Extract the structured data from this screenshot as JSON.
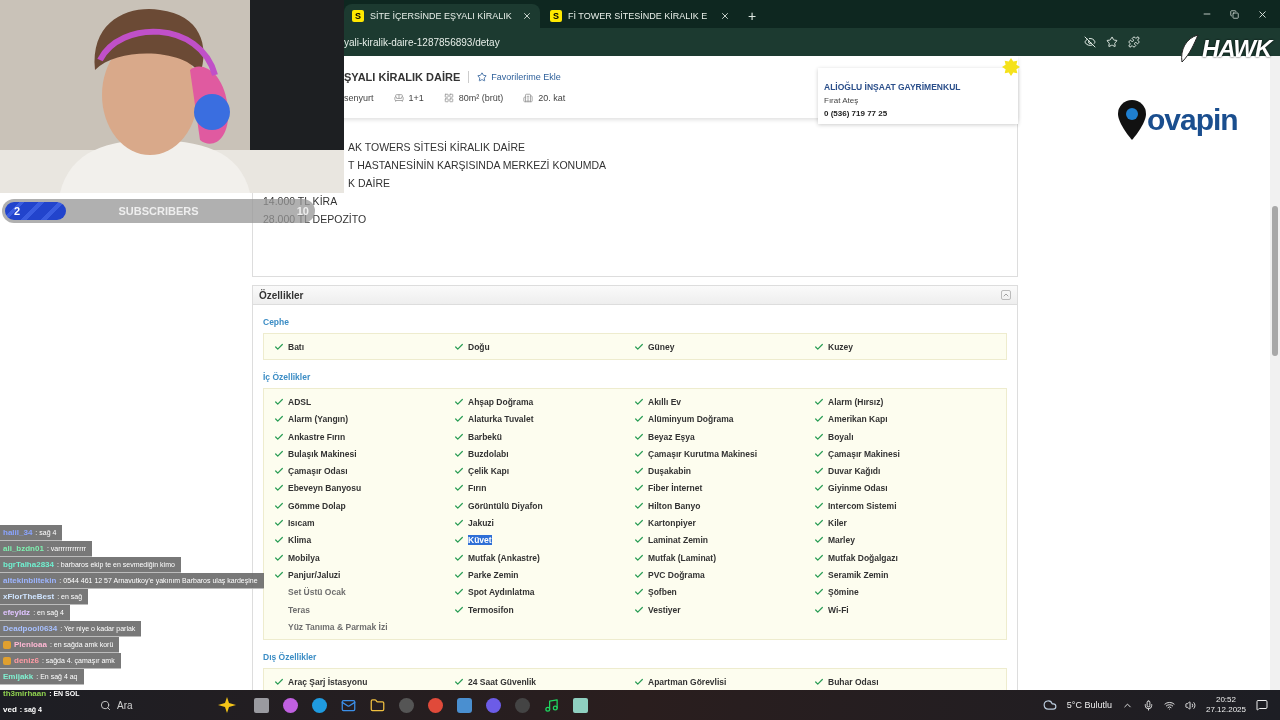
{
  "browser": {
    "tabs": [
      {
        "title": "SİTE İÇERSİNDE EŞYALI KİRALIK",
        "favicon": "S",
        "selected": true
      },
      {
        "title": "Fİ TOWER SİTESİNDE KİRALIK E",
        "favicon": "S",
        "selected": false
      }
    ],
    "new_tab": "+",
    "url": "yali-kiralik-daire-1287856893/detay"
  },
  "listing": {
    "title": "ŞYALI KİRALIK DAİRE",
    "favorite": "Favorilerime Ekle",
    "facts": [
      {
        "kind": "place",
        "text": "senyurt"
      },
      {
        "kind": "rooms",
        "text": "1+1"
      },
      {
        "kind": "area",
        "text": "80m² (brüt)"
      },
      {
        "kind": "floor",
        "text": "20. kat"
      }
    ],
    "seller": {
      "company": "ALİOĞLU İNŞAAT GAYRİMENKUL",
      "name": "Fırat Ateş",
      "phone": "0 (536) 719 77 25"
    },
    "description": [
      {
        "kind": "cut",
        "text": "AK TOWERS SİTESİ KİRALIK DAİRE"
      },
      {
        "kind": "cut",
        "text": "T HASTANESİNİN KARŞISINDA MERKEZİ KONUMDA"
      },
      {
        "kind": "cut",
        "text": "K DAİRE"
      },
      {
        "kind": "full",
        "text": "14.000 TL KİRA"
      },
      {
        "kind": "full",
        "text": "28.000 TL DEPOZİTO"
      }
    ]
  },
  "features": {
    "title": "Özellikler",
    "groups": [
      {
        "title": "Cephe",
        "columns": [
          [
            {
              "label": "Batı",
              "checked": true,
              "highlighted": false
            }
          ],
          [
            {
              "label": "Doğu",
              "checked": true,
              "highlighted": false
            }
          ],
          [
            {
              "label": "Güney",
              "checked": true,
              "highlighted": false
            }
          ],
          [
            {
              "label": "Kuzey",
              "checked": true,
              "highlighted": false
            }
          ]
        ]
      },
      {
        "title": "İç Özellikler",
        "columns": [
          [
            {
              "label": "ADSL",
              "checked": true,
              "highlighted": false
            },
            {
              "label": "Alarm (Yangın)",
              "checked": true,
              "highlighted": false
            },
            {
              "label": "Ankastre Fırın",
              "checked": true,
              "highlighted": false
            },
            {
              "label": "Bulaşık Makinesi",
              "checked": true,
              "highlighted": false
            },
            {
              "label": "Çamaşır Odası",
              "checked": true,
              "highlighted": false
            },
            {
              "label": "Ebeveyn Banyosu",
              "checked": true,
              "highlighted": false
            },
            {
              "label": "Gömme Dolap",
              "checked": true,
              "highlighted": false
            },
            {
              "label": "Isıcam",
              "checked": true,
              "highlighted": false
            },
            {
              "label": "Klima",
              "checked": true,
              "highlighted": false
            },
            {
              "label": "Mobilya",
              "checked": true,
              "highlighted": false
            },
            {
              "label": "Panjur/Jaluzi",
              "checked": true,
              "highlighted": false
            },
            {
              "label": "Set Üstü Ocak",
              "checked": false,
              "highlighted": false
            },
            {
              "label": "Teras",
              "checked": false,
              "highlighted": false
            },
            {
              "label": "Yüz Tanıma & Parmak İzi",
              "checked": false,
              "highlighted": false
            }
          ],
          [
            {
              "label": "Ahşap Doğrama",
              "checked": true,
              "highlighted": false
            },
            {
              "label": "Alaturka Tuvalet",
              "checked": true,
              "highlighted": false
            },
            {
              "label": "Barbekü",
              "checked": true,
              "highlighted": false
            },
            {
              "label": "Buzdolabı",
              "checked": true,
              "highlighted": false
            },
            {
              "label": "Çelik Kapı",
              "checked": true,
              "highlighted": false
            },
            {
              "label": "Fırın",
              "checked": true,
              "highlighted": false
            },
            {
              "label": "Görüntülü Diyafon",
              "checked": true,
              "highlighted": false
            },
            {
              "label": "Jakuzi",
              "checked": true,
              "highlighted": false
            },
            {
              "label": "Küvet",
              "checked": true,
              "highlighted": true
            },
            {
              "label": "Mutfak (Ankastre)",
              "checked": true,
              "highlighted": false
            },
            {
              "label": "Parke Zemin",
              "checked": true,
              "highlighted": false
            },
            {
              "label": "Spot Aydınlatma",
              "checked": true,
              "highlighted": false
            },
            {
              "label": "Termosifon",
              "checked": true,
              "highlighted": false
            }
          ],
          [
            {
              "label": "Akıllı Ev",
              "checked": true,
              "highlighted": false
            },
            {
              "label": "Alüminyum Doğrama",
              "checked": true,
              "highlighted": false
            },
            {
              "label": "Beyaz Eşya",
              "checked": true,
              "highlighted": false
            },
            {
              "label": "Çamaşır Kurutma Makinesi",
              "checked": true,
              "highlighted": false
            },
            {
              "label": "Duşakabin",
              "checked": true,
              "highlighted": false
            },
            {
              "label": "Fiber İnternet",
              "checked": true,
              "highlighted": false
            },
            {
              "label": "Hilton Banyo",
              "checked": true,
              "highlighted": false
            },
            {
              "label": "Kartonpiyer",
              "checked": true,
              "highlighted": false
            },
            {
              "label": "Laminat Zemin",
              "checked": true,
              "highlighted": false
            },
            {
              "label": "Mutfak (Laminat)",
              "checked": true,
              "highlighted": false
            },
            {
              "label": "PVC Doğrama",
              "checked": true,
              "highlighted": false
            },
            {
              "label": "Şofben",
              "checked": true,
              "highlighted": false
            },
            {
              "label": "Vestiyer",
              "checked": true,
              "highlighted": false
            }
          ],
          [
            {
              "label": "Alarm (Hırsız)",
              "checked": true,
              "highlighted": false
            },
            {
              "label": "Amerikan Kapı",
              "checked": true,
              "highlighted": false
            },
            {
              "label": "Boyalı",
              "checked": true,
              "highlighted": false
            },
            {
              "label": "Çamaşır Makinesi",
              "checked": true,
              "highlighted": false
            },
            {
              "label": "Duvar Kağıdı",
              "checked": true,
              "highlighted": false
            },
            {
              "label": "Giyinme Odası",
              "checked": true,
              "highlighted": false
            },
            {
              "label": "Intercom Sistemi",
              "checked": true,
              "highlighted": false
            },
            {
              "label": "Kiler",
              "checked": true,
              "highlighted": false
            },
            {
              "label": "Marley",
              "checked": true,
              "highlighted": false
            },
            {
              "label": "Mutfak Doğalgazı",
              "checked": true,
              "highlighted": false
            },
            {
              "label": "Seramik Zemin",
              "checked": true,
              "highlighted": false
            },
            {
              "label": "Şömine",
              "checked": true,
              "highlighted": false
            },
            {
              "label": "Wi-Fi",
              "checked": true,
              "highlighted": false
            }
          ]
        ]
      },
      {
        "title": "Dış Özellikler",
        "columns": [
          [
            {
              "label": "Araç Şarj İstasyonu",
              "checked": true,
              "highlighted": false
            }
          ],
          [
            {
              "label": "24 Saat Güvenlik",
              "checked": true,
              "highlighted": false
            }
          ],
          [
            {
              "label": "Apartman Görevlisi",
              "checked": true,
              "highlighted": false
            }
          ],
          [
            {
              "label": "Buhar Odası",
              "checked": true,
              "highlighted": false
            }
          ]
        ]
      }
    ]
  },
  "stream": {
    "subscribers": {
      "count": "2",
      "label": "SUBSCRIBERS",
      "goal": "10",
      "level": 0.2
    },
    "chat": [
      {
        "kind": "boxed",
        "user": "halil_34",
        "color": "#8aa4ff",
        "badge": false,
        "message": ": sağ 4"
      },
      {
        "kind": "boxed",
        "user": "ali_bzdn01",
        "color": "#7ff0b0",
        "badge": false,
        "message": ": varrrrrrrrrrrr"
      },
      {
        "kind": "boxed",
        "user": "bgrTalha2834",
        "color": "#70f0d0",
        "badge": false,
        "message": ": barbaros ekip te en sevmediğin kimo"
      },
      {
        "kind": "boxed",
        "user": "altekinbiltekin",
        "color": "#9cb4ff",
        "badge": false,
        "message": ": 0544 461 12 57 Arnavutkoy'e yakınım Barbaros ulaş kardeşine"
      },
      {
        "kind": "boxed",
        "user": "xFlorTheBest",
        "color": "#cfe4ff",
        "badge": false,
        "message": ": en sağ"
      },
      {
        "kind": "boxed",
        "user": "efeyldz",
        "color": "#e0c4ff",
        "badge": false,
        "message": ": en sağ 4"
      },
      {
        "kind": "boxed",
        "user": "Deadpool0634",
        "color": "#a8c0ff",
        "badge": false,
        "message": ": Yer niye o kadar parlak"
      },
      {
        "kind": "boxed",
        "user": "Plenloaa",
        "color": "#ffb8d4",
        "badge": true,
        "message": ": en sağda amk korü"
      },
      {
        "kind": "boxed",
        "user": "deniz6",
        "color": "#ff9aa4",
        "badge": true,
        "message": ": sağda 4. çamaşır amk"
      },
      {
        "kind": "boxed",
        "user": "Emijakk",
        "color": "#80f0d0",
        "badge": false,
        "message": ": En sağ 4 aq"
      },
      {
        "kind": "plain",
        "user": "th3mirhaan",
        "color": "#8fd14f",
        "badge": false,
        "message": ": EN SOL"
      },
      {
        "kind": "plain",
        "user": "ved",
        "color": "#ffffff",
        "badge": false,
        "message": ": sağ 4"
      }
    ],
    "logo": "HAWK",
    "sponsor": "ovapin"
  },
  "taskbar": {
    "search": "Ara",
    "weather": "5°C Bulutlu",
    "time": "20:52",
    "date": "27.12.2025"
  }
}
